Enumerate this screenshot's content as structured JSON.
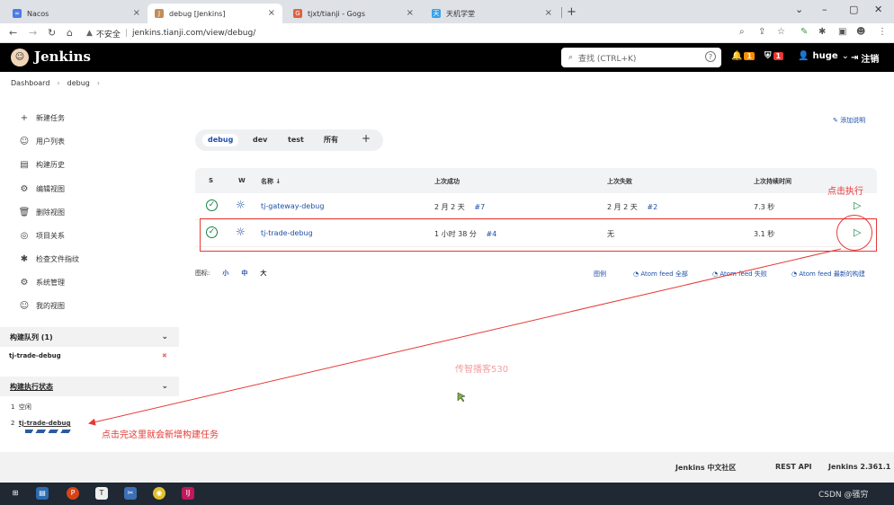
{
  "browser": {
    "tabs": [
      {
        "label": "Nacos",
        "favicon": "∞",
        "color": "#4a7be6"
      },
      {
        "label": "debug [Jenkins]",
        "favicon": "J",
        "color": "#c48b5a"
      },
      {
        "label": "tjxt/tianji - Gogs",
        "favicon": "G",
        "color": "#e06040"
      },
      {
        "label": "天机学堂",
        "favicon": "天",
        "color": "#3ba0e6"
      }
    ],
    "url_warning": "不安全",
    "url": "jenkins.tianji.com/view/debug/"
  },
  "header": {
    "title": "Jenkins",
    "search_placeholder": "查找 (CTRL+K)",
    "help": "?",
    "notif_count": "1",
    "security_count": "1",
    "user": "huge",
    "logout": "注销"
  },
  "breadcrumb": {
    "root": "Dashboard",
    "current": "debug"
  },
  "sidebar": {
    "items": [
      {
        "label": "新建任务",
        "icon": "+"
      },
      {
        "label": "用户列表",
        "icon": "☺"
      },
      {
        "label": "构建历史",
        "icon": "▤"
      },
      {
        "label": "编辑视图",
        "icon": "⚙"
      },
      {
        "label": "删除视图",
        "icon": "🗑"
      },
      {
        "label": "项目关系",
        "icon": "◎"
      },
      {
        "label": "检查文件指纹",
        "icon": "✱"
      },
      {
        "label": "系统管理",
        "icon": "⚙"
      },
      {
        "label": "我的视图",
        "icon": "☺"
      }
    ],
    "queue_title": "构建队列 (1)",
    "queue_item": "tj-trade-debug",
    "queue_cancel": "✖",
    "exec_title": "构建执行状态",
    "exec_items": [
      {
        "num": "1",
        "label": "空闲"
      },
      {
        "num": "2",
        "label": "tj-trade-debug"
      }
    ]
  },
  "main": {
    "add_description": "添加说明",
    "view_tabs": [
      "debug",
      "dev",
      "test",
      "所有"
    ],
    "add_tab": "+",
    "columns": [
      "S",
      "W",
      "名称 ↓",
      "上次成功",
      "上次失败",
      "上次持续时间"
    ],
    "rows": [
      {
        "name": "tj-gateway-debug",
        "last_success": "2 月 2 天",
        "success_build": "#7",
        "last_failure": "2 月 2 天",
        "failure_build": "#2",
        "duration": "7.3 秒"
      },
      {
        "name": "tj-trade-debug",
        "last_success": "1 小时 38 分",
        "success_build": "#4",
        "last_failure": "无",
        "failure_build": "",
        "duration": "3.1 秒"
      }
    ],
    "icon_label": "图标:",
    "icon_sizes": [
      "小",
      "中",
      "大"
    ],
    "legend": "图例",
    "atom_all": "Atom feed 全部",
    "atom_failed": "Atom feed 失败",
    "atom_latest": "Atom feed 最新的构建"
  },
  "annotations": {
    "click_run": "点击执行",
    "result_note": "点击完这里就会新增构建任务",
    "watermark": "传智播客530"
  },
  "footer": {
    "community": "Jenkins 中文社区",
    "rest_api": "REST API",
    "version": "Jenkins 2.361.1"
  },
  "taskbar": {
    "text": "CSDN @骚穷"
  }
}
